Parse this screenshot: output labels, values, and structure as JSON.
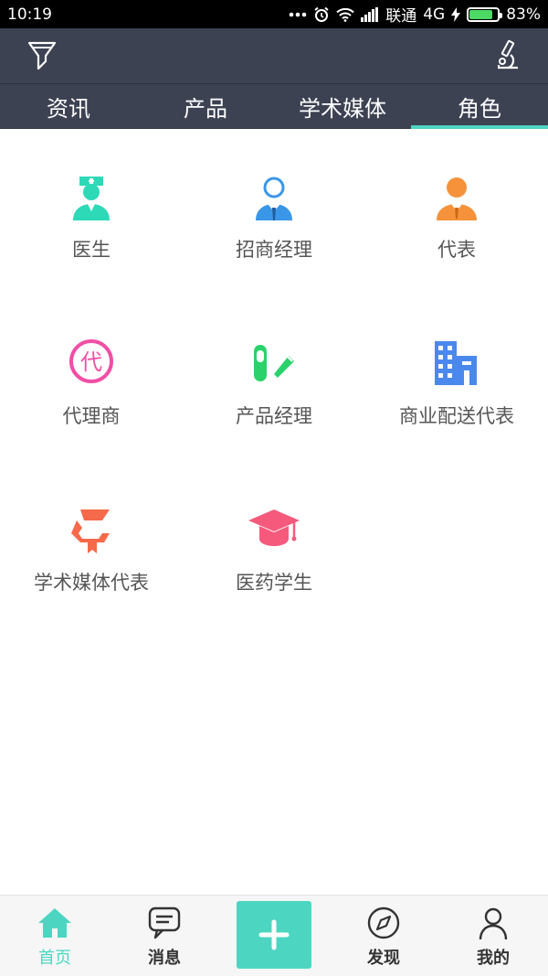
{
  "status_bar": {
    "time": "10:19",
    "carrier": "联通",
    "network": "4G",
    "battery": "83%",
    "battery_level": 0.83
  },
  "top_bar": {
    "left_icon": "filter-icon",
    "right_icon": "microscope-icon"
  },
  "tabs": [
    {
      "label": "资讯"
    },
    {
      "label": "产品"
    },
    {
      "label": "学术媒体"
    },
    {
      "label": "角色"
    }
  ],
  "active_tab": 3,
  "roles": [
    {
      "label": "医生",
      "icon": "nurse-icon",
      "color": "#2ed9b8"
    },
    {
      "label": "招商经理",
      "icon": "businessman-icon",
      "color": "#3a97e8"
    },
    {
      "label": "代表",
      "icon": "representative-icon",
      "color": "#f5923a"
    },
    {
      "label": "代理商",
      "icon": "agent-icon",
      "color": "#f04fa5",
      "glyph": "代"
    },
    {
      "label": "产品经理",
      "icon": "pill-icon",
      "color": "#2bd26b"
    },
    {
      "label": "商业配送代表",
      "icon": "building-icon",
      "color": "#4a88ee"
    },
    {
      "label": "学术媒体代表",
      "icon": "book-icon",
      "color": "#f56a4a"
    },
    {
      "label": "医药学生",
      "icon": "graduation-cap-icon",
      "color": "#f55a7d"
    }
  ],
  "bottom_nav": {
    "home": "首页",
    "messages": "消息",
    "add": "+",
    "discover": "发现",
    "mine": "我的",
    "accent": "#4cd6c2"
  }
}
